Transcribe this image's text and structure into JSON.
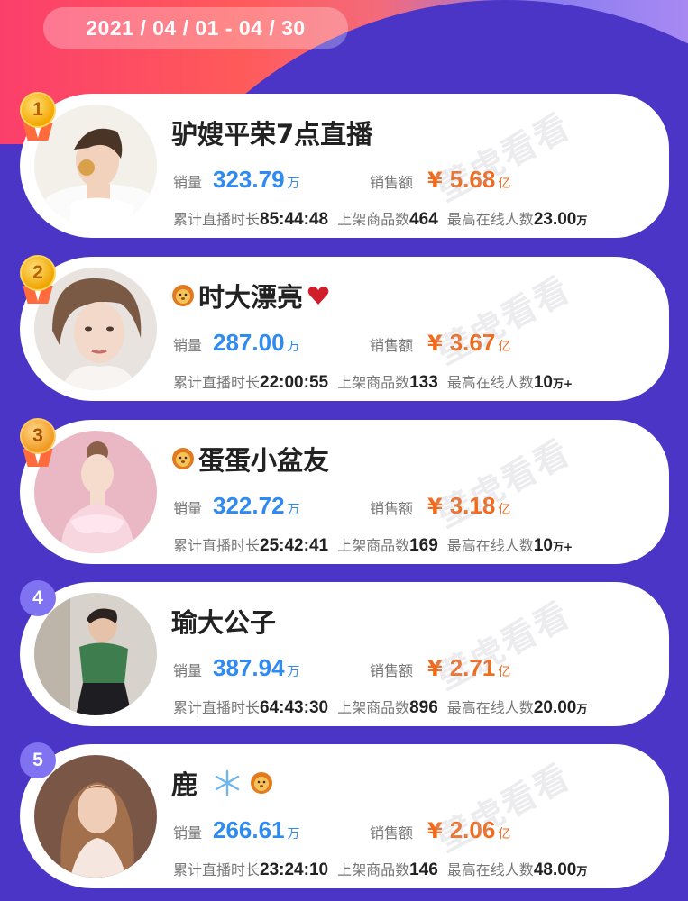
{
  "header": {
    "date_range": "2021 / 04 / 01 - 04 / 30"
  },
  "labels": {
    "sales_volume": "销量",
    "sales_amount": "销售额",
    "currency": "¥",
    "cumulative_duration": "累计直播时长",
    "products_listed": "上架商品数",
    "peak_online": "最高在线人数"
  },
  "watermark": "壁虎看看",
  "colors": {
    "sales_blue": "#2f8bef",
    "amount_orange": "#f26a1b",
    "background": "#4a35c6"
  },
  "rankings": [
    {
      "rank": "1",
      "name": "驴嫂平荣7点直播",
      "badges": [],
      "sales_volume": "323.79",
      "sales_unit": "万",
      "sales_amount": "5.68",
      "amount_unit": "亿",
      "duration": "85:44:48",
      "products": "464",
      "peak_online": "23.00",
      "peak_unit": "万"
    },
    {
      "rank": "2",
      "name": "时大漂亮",
      "badges": [
        "lion-icon",
        "heart-icon"
      ],
      "sales_volume": "287.00",
      "sales_unit": "万",
      "sales_amount": "3.67",
      "amount_unit": "亿",
      "duration": "22:00:55",
      "products": "133",
      "peak_online": "10",
      "peak_unit": "万+"
    },
    {
      "rank": "3",
      "name": "蛋蛋小盆友",
      "badges": [
        "lion-icon"
      ],
      "sales_volume": "322.72",
      "sales_unit": "万",
      "sales_amount": "3.18",
      "amount_unit": "亿",
      "duration": "25:42:41",
      "products": "169",
      "peak_online": "10",
      "peak_unit": "万+"
    },
    {
      "rank": "4",
      "name": "瑜大公子",
      "badges": [],
      "sales_volume": "387.94",
      "sales_unit": "万",
      "sales_amount": "2.71",
      "amount_unit": "亿",
      "duration": "64:43:30",
      "products": "896",
      "peak_online": "20.00",
      "peak_unit": "万"
    },
    {
      "rank": "5",
      "name": "鹿",
      "badges": [
        "snowflake-icon",
        "lion-icon"
      ],
      "sales_volume": "266.61",
      "sales_unit": "万",
      "sales_amount": "2.06",
      "amount_unit": "亿",
      "duration": "23:24:10",
      "products": "146",
      "peak_online": "48.00",
      "peak_unit": "万"
    }
  ]
}
